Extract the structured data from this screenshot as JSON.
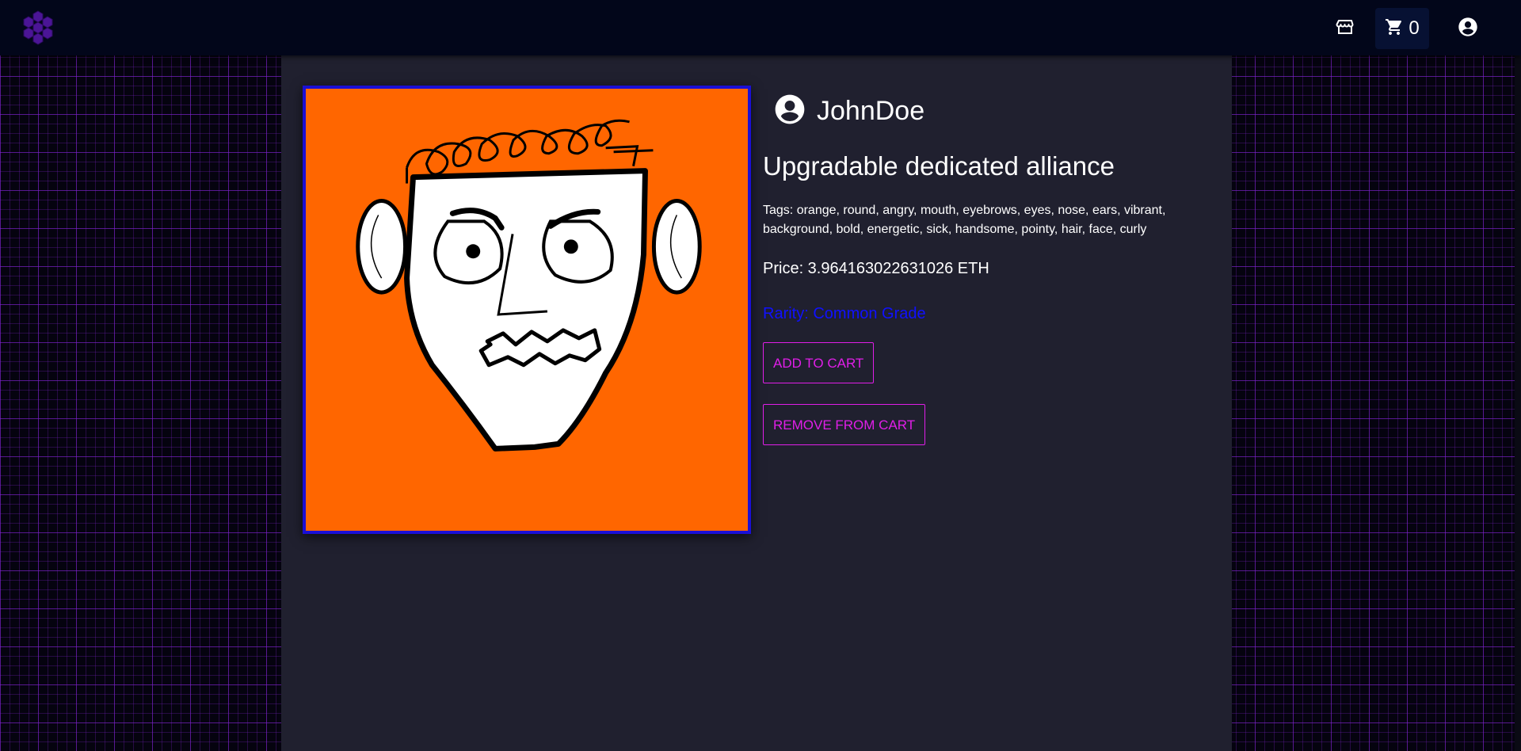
{
  "header": {
    "logo_icon": "hexagon-cluster-logo",
    "store_icon": "storefront-icon",
    "cart_icon": "shopping-cart-icon",
    "cart_count": "0",
    "account_icon": "account-circle-icon"
  },
  "nft": {
    "owner": "JohnDoe",
    "title": "Upgradable dedicated alliance",
    "tags_text": "Tags: orange, round, angry, mouth, eyebrows, eyes, nose, ears, vibrant, background, bold, energetic, sick, handsome, pointy, hair, face, curly",
    "price_text": "Price: 3.964163022631026 ETH",
    "rarity_text": "Rarity: Common Grade",
    "artwork_description_colors": {
      "background": "#ff6600",
      "frame": "#1a0fd6"
    }
  },
  "actions": {
    "add_to_cart": "ADD TO CART",
    "remove_from_cart": "REMOVE FROM CART"
  },
  "colors": {
    "accent": "#e01ee8",
    "rarity": "#1010ff",
    "panel": "#20202f",
    "appbar": "#02061a"
  }
}
